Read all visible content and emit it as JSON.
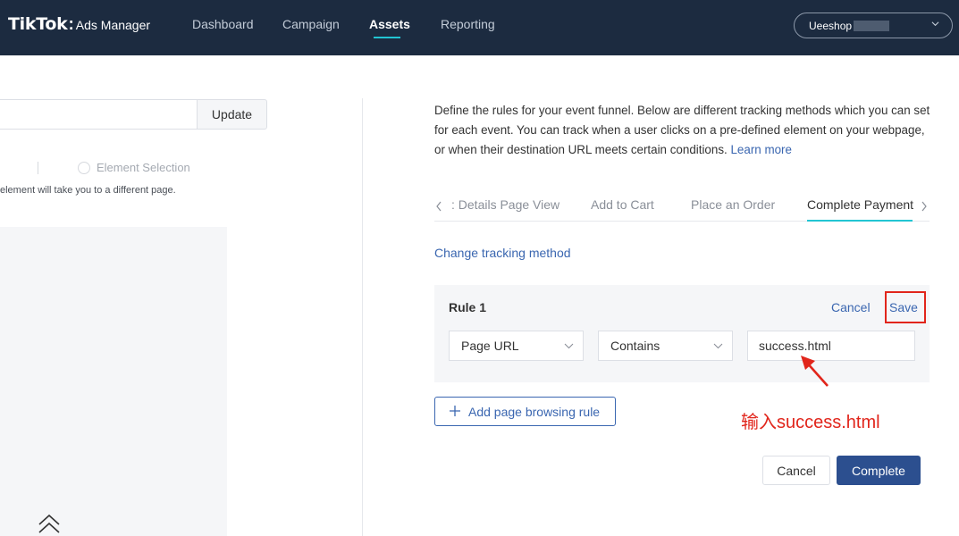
{
  "header": {
    "logo": "TikTok",
    "logo_separator": ":",
    "product": "Ads Manager",
    "nav": [
      "Dashboard",
      "Campaign",
      "Assets",
      "Reporting"
    ],
    "active_nav": "Assets",
    "account_name": "Ueeshop",
    "icons": [
      "chevron-down-icon"
    ]
  },
  "left_panel": {
    "update_label": "Update",
    "radio_option": "Element Selection",
    "hint": "element will take you to a different page.",
    "icons": [
      "double-chevron-up-icon"
    ]
  },
  "description": {
    "text": "Define the rules for your event funnel. Below are different tracking methods which you can set for each event. You can track when a user clicks on a pre-defined element on your webpage, or when their destination URL meets certain conditions.",
    "learn_more": "Learn more"
  },
  "tabs": {
    "items": [
      ": Details Page View",
      "Add to Cart",
      "Place an Order",
      "Complete Payment"
    ],
    "active": "Complete Payment",
    "icons": [
      "chevron-left-icon",
      "chevron-right-icon"
    ]
  },
  "change_tracking_method": "Change tracking method",
  "rule": {
    "title": "Rule 1",
    "cancel_label": "Cancel",
    "save_label": "Save",
    "field_select": "Page URL",
    "operator_select": "Contains",
    "value": "success.html"
  },
  "add_rule_label": "Add page browsing rule",
  "annotation": "输入success.html",
  "footer": {
    "cancel_label": "Cancel",
    "complete_label": "Complete"
  },
  "colors": {
    "header_bg": "#1c2b40",
    "accent_teal": "#22c5d3",
    "link_blue": "#3a66b0",
    "primary_button": "#2c4f8f",
    "annotation_red": "#e1251b"
  }
}
